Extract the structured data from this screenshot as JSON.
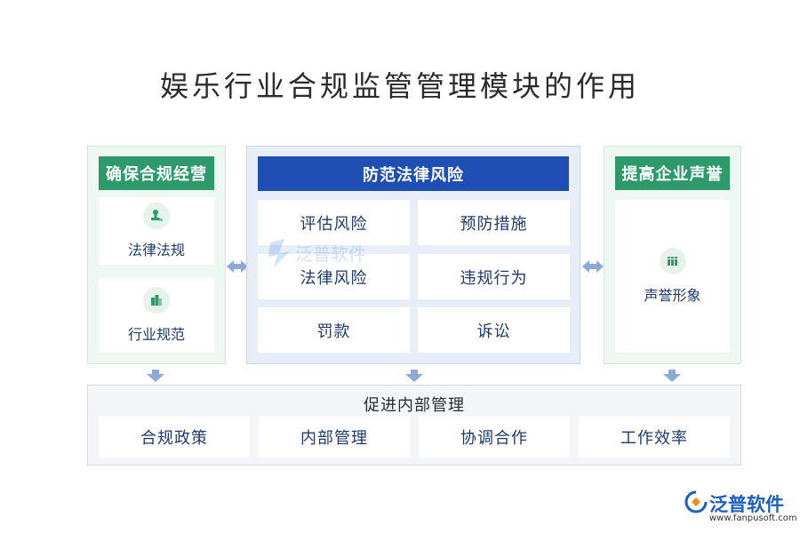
{
  "title": "娱乐行业合规监管管理模块的作用",
  "left_panel": {
    "header": "确保合规经营",
    "items": [
      {
        "label": "法律法规",
        "icon": "stamp-icon"
      },
      {
        "label": "行业规范",
        "icon": "building-icon"
      }
    ]
  },
  "center_panel": {
    "header": "防范法律风险",
    "items": [
      "评估风险",
      "预防措施",
      "法律风险",
      "违规行为",
      "罚款",
      "诉讼"
    ],
    "watermark": "泛普软件"
  },
  "right_panel": {
    "header": "提高企业声誉",
    "items": [
      {
        "label": "声誉形象",
        "icon": "books-icon"
      }
    ]
  },
  "bottom_panel": {
    "header": "促进内部管理",
    "items": [
      "合规政策",
      "内部管理",
      "协调合作",
      "工作效率"
    ]
  },
  "logo": {
    "name": "泛普软件",
    "url": "www.fanpusoft.com"
  },
  "colors": {
    "green": "#2e9a6c",
    "blue": "#1f4fb3",
    "arrow": "#8fa8d8",
    "text": "#1f3a6e"
  }
}
